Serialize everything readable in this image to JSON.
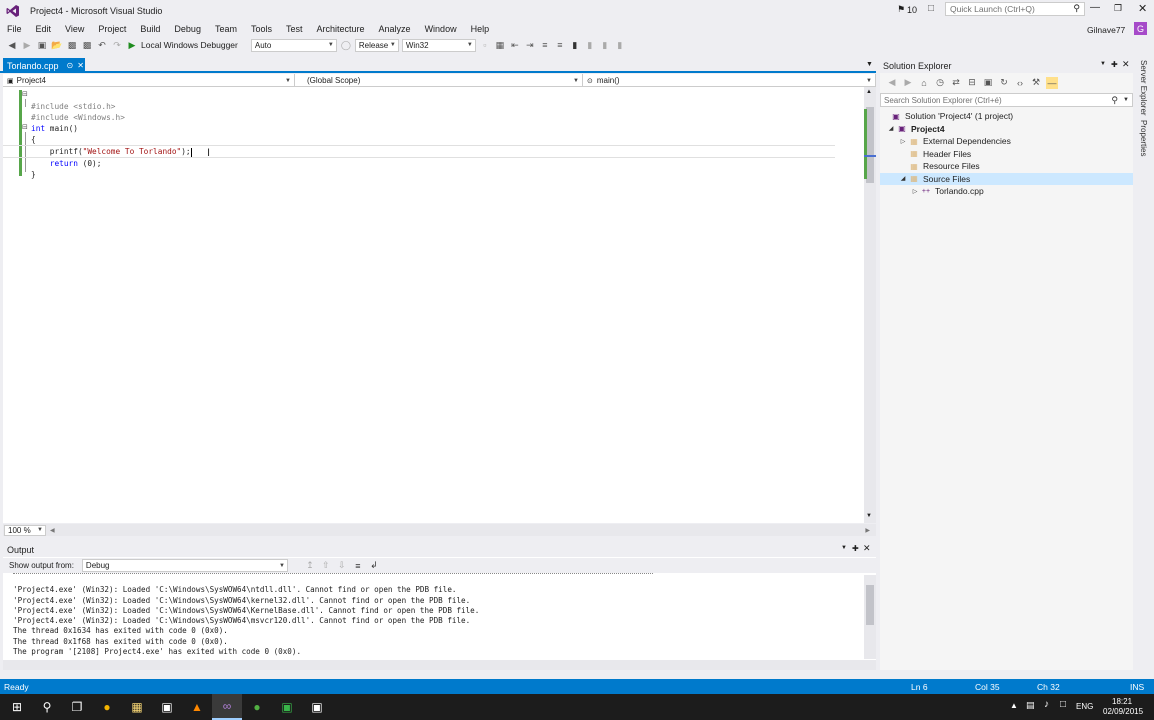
{
  "window": {
    "title": "Project4 - Microsoft Visual Studio",
    "notifications": "10",
    "quick_launch_placeholder": "Quick Launch (Ctrl+Q)",
    "user": "Gilnave77",
    "user_initial": "G"
  },
  "menu": [
    "File",
    "Edit",
    "View",
    "Project",
    "Build",
    "Debug",
    "Team",
    "Tools",
    "Test",
    "Architecture",
    "Analyze",
    "Window",
    "Help"
  ],
  "toolbar": {
    "debugger_label": "Local Windows Debugger",
    "solution_config": "Auto",
    "build_config": "Release",
    "platform": "Win32"
  },
  "editor": {
    "tab_label": "Torlando.cpp",
    "nav_project": "Project4",
    "nav_scope": "(Global Scope)",
    "nav_function": "main()",
    "zoom": "100 %",
    "code_lines": [
      "#include <stdio.h>",
      "#include <Windows.h>",
      "",
      "int main()",
      "{",
      "    printf(\"Welcome To Torlando\");",
      "    return (0);",
      "}"
    ]
  },
  "output": {
    "title": "Output",
    "show_from_label": "Show output from:",
    "show_from_value": "Debug",
    "lines": [
      "'Project4.exe' (Win32): Loaded 'C:\\Windows\\SysWOW64\\ntdll.dll'. Cannot find or open the PDB file.",
      "'Project4.exe' (Win32): Loaded 'C:\\Windows\\SysWOW64\\kernel32.dll'. Cannot find or open the PDB file.",
      "'Project4.exe' (Win32): Loaded 'C:\\Windows\\SysWOW64\\KernelBase.dll'. Cannot find or open the PDB file.",
      "'Project4.exe' (Win32): Loaded 'C:\\Windows\\SysWOW64\\msvcr120.dll'. Cannot find or open the PDB file.",
      "The thread 0x1634 has exited with code 0 (0x0).",
      "The thread 0x1f68 has exited with code 0 (0x0).",
      "The program '[2108] Project4.exe' has exited with code 0 (0x0)."
    ]
  },
  "solution_explorer": {
    "title": "Solution Explorer",
    "search_placeholder": "Search Solution Explorer (Ctrl+é)",
    "solution": "Solution 'Project4' (1 project)",
    "project": "Project4",
    "items": [
      "External Dependencies",
      "Header Files",
      "Resource Files",
      "Source Files"
    ],
    "source_file": "Torlando.cpp",
    "side_tabs": [
      "Server Explorer",
      "Properties"
    ]
  },
  "status": {
    "ready": "Ready",
    "line": "Ln 6",
    "col": "Col 35",
    "ch": "Ch 32",
    "mode": "INS"
  },
  "taskbar": {
    "lang": "ENG",
    "time": "18:21",
    "date": "02/09/2015"
  },
  "colors": {
    "accent": "#007acc",
    "keyword": "#0000ff",
    "preprocessor": "#808080",
    "string": "#a31515"
  }
}
